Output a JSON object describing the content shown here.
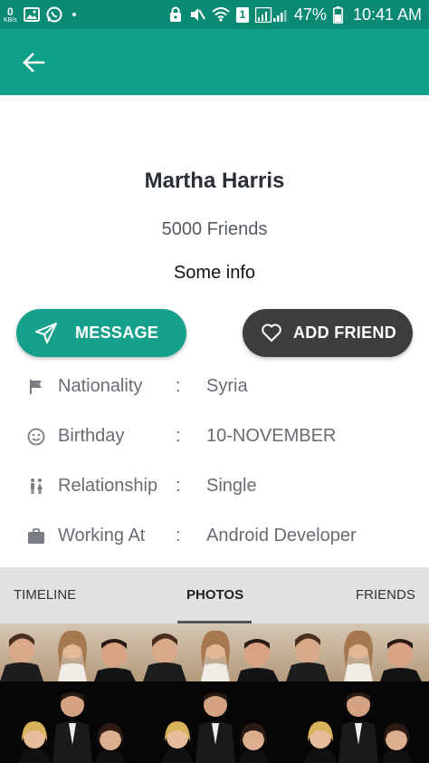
{
  "status_bar": {
    "speed_value": "0",
    "speed_unit": "KB/s",
    "battery": "47%",
    "time": "10:41 AM",
    "sim_badge": "1",
    "color": "#0b8a73"
  },
  "app_bar": {
    "color": "#0fa08a",
    "back_icon": "arrow-left-icon"
  },
  "profile": {
    "name": "Martha Harris",
    "friends": "5000 Friends",
    "info": "Some info"
  },
  "buttons": {
    "message": {
      "label": "MESSAGE",
      "icon": "send-icon",
      "color": "#17a18c"
    },
    "add_friend": {
      "label": "ADD FRIEND",
      "icon": "heart-icon",
      "color": "#3d3d3d"
    }
  },
  "details": [
    {
      "icon": "flag-icon",
      "label": "Nationality",
      "separator": ":",
      "value": "Syria"
    },
    {
      "icon": "smiley-icon",
      "label": "Birthday",
      "separator": ":",
      "value": "10-NOVEMBER"
    },
    {
      "icon": "couple-icon",
      "label": "Relationship",
      "separator": ":",
      "value": "Single"
    },
    {
      "icon": "briefcase-icon",
      "label": "Working At",
      "separator": ":",
      "value": "Android Developer"
    }
  ],
  "tabs": [
    {
      "label": "TIMELINE",
      "selected": false
    },
    {
      "label": "PHOTOS",
      "selected": true
    },
    {
      "label": "FRIENDS",
      "selected": false
    }
  ],
  "photos": {
    "rows": 2,
    "columns": 3
  }
}
